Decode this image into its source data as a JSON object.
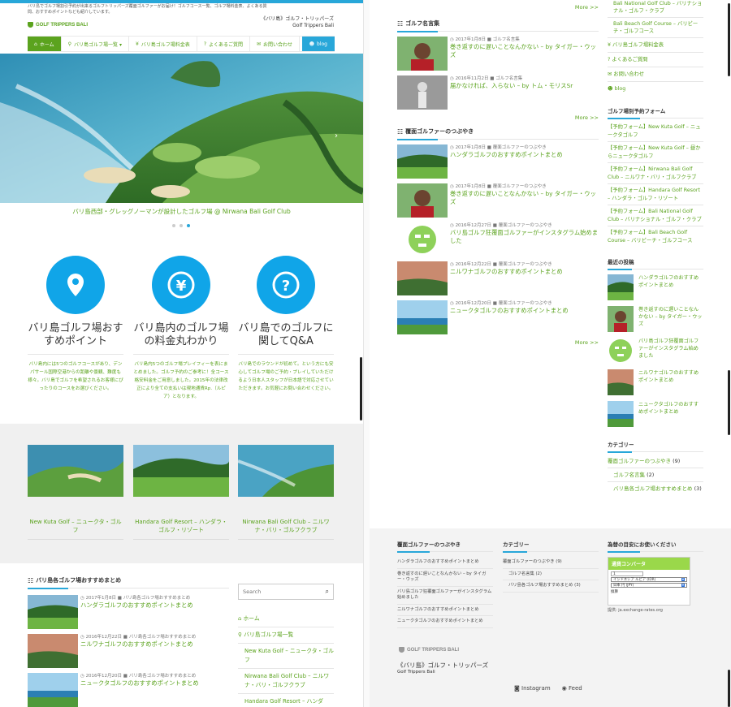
{
  "site": {
    "tagline": "バリ島でゴルフ場割引予約が出来るゴルフトリッパーズ覆面ゴルファーがお届け！ゴルフコース一覧、ゴルフ場料金表、よくある質問、おすすめポイントなども紹介しています。",
    "logo_text": "GOLF TRIPPERS BALI",
    "name_jp": "《バリ島》ゴルフ・トリッパーズ",
    "name_en": "Golf Trippers Bali"
  },
  "nav": {
    "items": [
      {
        "icon": "home-icon",
        "label": "ホーム"
      },
      {
        "icon": "pin-icon",
        "label": "バリ島ゴルフ場一覧 ▾"
      },
      {
        "icon": "yen-icon",
        "label": "バリ島ゴルフ場料金表"
      },
      {
        "icon": "question-icon",
        "label": "よくあるご質問"
      },
      {
        "icon": "mail-icon",
        "label": "お問い合わせ"
      },
      {
        "icon": "blog-icon",
        "label": "blog"
      }
    ]
  },
  "hero": {
    "caption": "バリ島西部・グレッグノーマンが設計したゴルフ場 @ Nirwana Bali Golf Club",
    "slide_count": 3,
    "active_slide": 3
  },
  "features": [
    {
      "icon": "pin-icon",
      "title": "バリ島ゴルフ場おすすめポイント",
      "text": "バリ島内には5つのゴルフコースがあり、デンパサール国際空港からの距離や景観、難度も様々。バリ島でゴルフを希望されるお客様にぴったりのコースをお選びください。"
    },
    {
      "icon": "yen-icon",
      "title": "バリ島内のゴルフ場の料金丸わかり",
      "text": "バリ島内5つのゴルフ場プレイフィーを表にまとめました。ゴルフ予約のご参考に！全コース格安料金をご用意しました。2015年の法律改正により全ての支払いは現地通貨Rp.（ルピア）となります。"
    },
    {
      "icon": "question-icon",
      "title": "バリ島でのゴルフに関してQ&A",
      "text": "バリ島でのラウンドが初めて。という方にも安心してゴルフ場のご予約・プレイしていただけるよう日本人スタッフが日本語で対応させていただきます。お気軽にお問い合わせください。"
    }
  ],
  "courses": [
    {
      "title": "New Kuta Golf – ニュークタ・ゴルフ"
    },
    {
      "title": "Handara Golf Resort – ハンダラ・ゴルフ・リゾート"
    },
    {
      "title": "Nirwana Bali Golf Club – ニルワナ・バリ・ゴルフクラブ"
    }
  ],
  "recommend": {
    "heading": "バリ島各ゴルフ場おすすめまとめ",
    "posts": [
      {
        "date": "2017年1月8日",
        "cat": "バリ島各ゴルフ場おすすめまとめ",
        "title": "ハンダラゴルフのおすすめポイントまとめ"
      },
      {
        "date": "2016年12月22日",
        "cat": "バリ島各ゴルフ場おすすめまとめ",
        "title": "ニルワナゴルフのおすすめポイントまとめ"
      },
      {
        "date": "2016年12月20日",
        "cat": "バリ島各ゴルフ場おすすめまとめ",
        "title": "ニュークタゴルフのおすすめポイントまとめ"
      }
    ]
  },
  "search": {
    "placeholder": "Search"
  },
  "left_sidebar": {
    "home": "ホーム",
    "list": "バリ島ゴルフ場一覧",
    "links": [
      "New Kuta Golf – ニュークタ・ゴルフ",
      "Nirwana Bali Golf Club – ニルワナ・バリ・ゴルフクラブ",
      "Handara Golf Resort – ハンダラ・ゴルフ・リゾート"
    ]
  },
  "right_main": {
    "more": "More >>",
    "meigen": {
      "heading": "ゴルフ名言集",
      "posts": [
        {
          "date": "2017年1月8日",
          "cat": "ゴルフ名言集",
          "title": "巻き返すのに遅いことなんかない – by タイガー・ウッズ"
        },
        {
          "date": "2016年11月2日",
          "cat": "ゴルフ名言集",
          "title": "届かなければ、入らない – by トム・モリスSr"
        }
      ]
    },
    "tsubuyaki": {
      "heading": "覆面ゴルファーのつぶやき",
      "posts": [
        {
          "date": "2017年1月8日",
          "cat": "覆面ゴルファーのつぶやき",
          "title": "ハンダラゴルフのおすすめポイントまとめ"
        },
        {
          "date": "2017年1月8日",
          "cat": "覆面ゴルファーのつぶやき",
          "title": "巻き返すのに遅いことなんかない – by タイガー・ウッズ"
        },
        {
          "date": "2016年12月27日",
          "cat": "覆面ゴルファーのつぶやき",
          "title": "バリ島ゴルフ狂覆面ゴルファーがインスタグラム始めました"
        },
        {
          "date": "2016年12月22日",
          "cat": "覆面ゴルファーのつぶやき",
          "title": "ニルワナゴルフのおすすめポイントまとめ"
        },
        {
          "date": "2016年12月20日",
          "cat": "覆面ゴルファーのつぶやき",
          "title": "ニュークタゴルフのおすすめポイントまとめ"
        }
      ]
    }
  },
  "right_sidebar": {
    "top_links": [
      "Bali National Golf Club – バリナショナル・ゴルフ・クラブ",
      "Bali Beach Golf Course – バリビーチ・ゴルフコース"
    ],
    "nav_links": [
      "バリ島ゴルフ場料金表",
      "よくあるご質問",
      "お問い合わせ",
      "blog"
    ],
    "form_heading": "ゴルフ場別予約フォーム",
    "forms": [
      "【予約フォーム】New Kuta Golf – ニュークタゴルフ",
      "【予約フォーム】New Kuta Golf – 昼からニュークタゴルフ",
      "【予約フォーム】Nirwana Bali Golf Club – ニルワナ・バリ・ゴルフクラブ",
      "【予約フォーム】Handara Golf Resort – ハンダラ・ゴルフ・リゾート",
      "【予約フォーム】Bali National Golf Club – バリナショナル・ゴルフ・クラブ",
      "【予約フォーム】Bali Beach Golf Course – バリビーチ・ゴルフコース"
    ],
    "recent_heading": "最近の投稿",
    "recent": [
      "ハンダラゴルフのおすすめポイントまとめ",
      "巻き返すのに遅いことなんかない – by タイガー・ウッズ",
      "バリ島ゴルフ狂覆面ゴルファーがインスタグラム始めました",
      "ニルワナゴルフのおすすめポイントまとめ",
      "ニュークタゴルフのおすすめポイントまとめ"
    ],
    "cat_heading": "カテゴリー",
    "cats": [
      {
        "label": "覆面ゴルファーのつぶやき",
        "count": "(9)"
      },
      {
        "label": "ゴルフ名言集",
        "count": "(2)"
      },
      {
        "label": "バリ島各ゴルフ場おすすめまとめ",
        "count": "(3)"
      }
    ]
  },
  "footer": {
    "col1_heading": "覆面ゴルファーのつぶやき",
    "col1": [
      "ハンダラゴルフのおすすめポイントまとめ",
      "巻き返すのに遅いことなんかない – by タイガー・ウッズ",
      "バリ島ゴルフ狂覆面ゴルファーがインスタグラム始めました",
      "ニルワナゴルフのおすすめポイントまとめ",
      "ニュークタゴルフのおすすめポイントまとめ"
    ],
    "col2_heading": "カテゴリー",
    "col2": [
      "覆面ゴルファーのつぶやき (9)",
      "ゴルフ名言集 (2)",
      "バリ島各ゴルフ場おすすめまとめ (3)"
    ],
    "col3_heading": "為替の目安にお使いください",
    "converter": {
      "title": "通貨コンバータ",
      "amount": "1",
      "from": "インドネシア ルピア (IDR)",
      "to": "日本 円 (JPY)",
      "button": "換算",
      "source": "提供: ja.exchange-rates.org"
    },
    "logo_text": "GOLF TRIPPERS BALI",
    "name_jp": "《バリ島》ゴルフ・トリッパーズ",
    "name_en": "Golf Trippers Bali",
    "instagram": "Instagram",
    "feed": "Feed"
  },
  "colors": {
    "green": "#5ba31e",
    "blue": "#28a7d9",
    "feature_blue": "#10a5e8"
  }
}
